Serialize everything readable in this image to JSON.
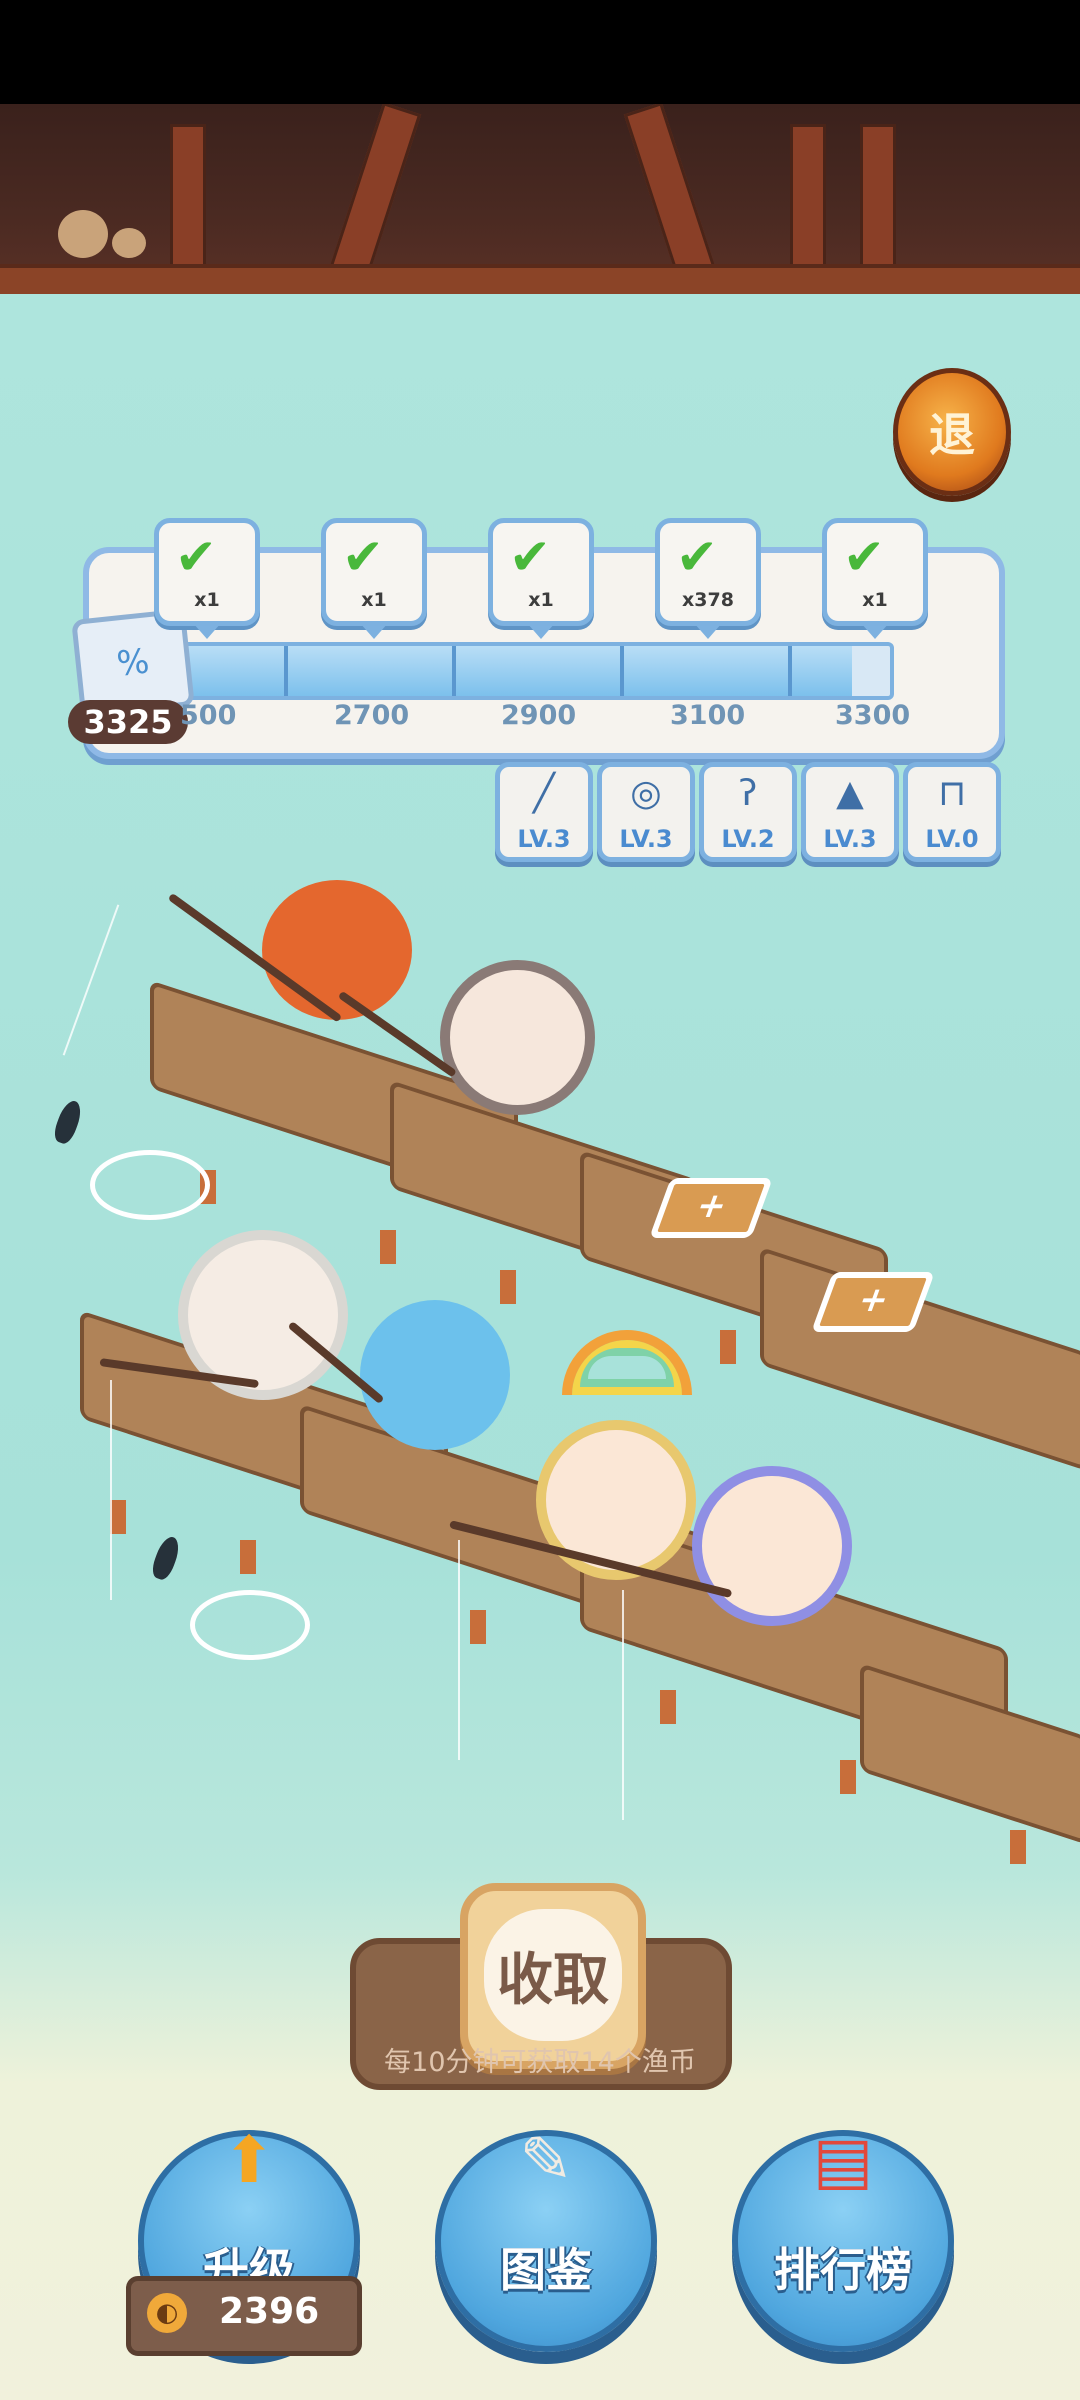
{
  "exit_button": {
    "label": "退"
  },
  "progress": {
    "current_score": "3325",
    "fill_fraction": 0.95,
    "milestones": [
      {
        "count": "x1",
        "score": "2500",
        "label_shown": "500",
        "claimed": true
      },
      {
        "count": "x1",
        "score": "2700",
        "label_shown": "2700",
        "claimed": true
      },
      {
        "count": "x1",
        "score": "2900",
        "label_shown": "2900",
        "claimed": true
      },
      {
        "count": "x378",
        "score": "3100",
        "label_shown": "3100",
        "claimed": true
      },
      {
        "count": "x1",
        "score": "3300",
        "label_shown": "3300",
        "claimed": true
      }
    ]
  },
  "gear": [
    {
      "icon": "fishing-rod-icon",
      "level": "LV.3"
    },
    {
      "icon": "reel-icon",
      "level": "LV.3"
    },
    {
      "icon": "hook-icon",
      "level": "LV.2"
    },
    {
      "icon": "hat-icon",
      "level": "LV.3"
    },
    {
      "icon": "stool-icon",
      "level": "LV.0"
    }
  ],
  "collect": {
    "label": "收取",
    "hint": "每10分钟可获取14个渔币"
  },
  "bottom_nav": {
    "upgrade": "升级",
    "collection": "图鉴",
    "leaderboard": "排行榜"
  },
  "coins": "2396",
  "colors": {
    "accent_blue": "#7db1e0",
    "wood": "#b08358",
    "water": "#a9e3db"
  }
}
